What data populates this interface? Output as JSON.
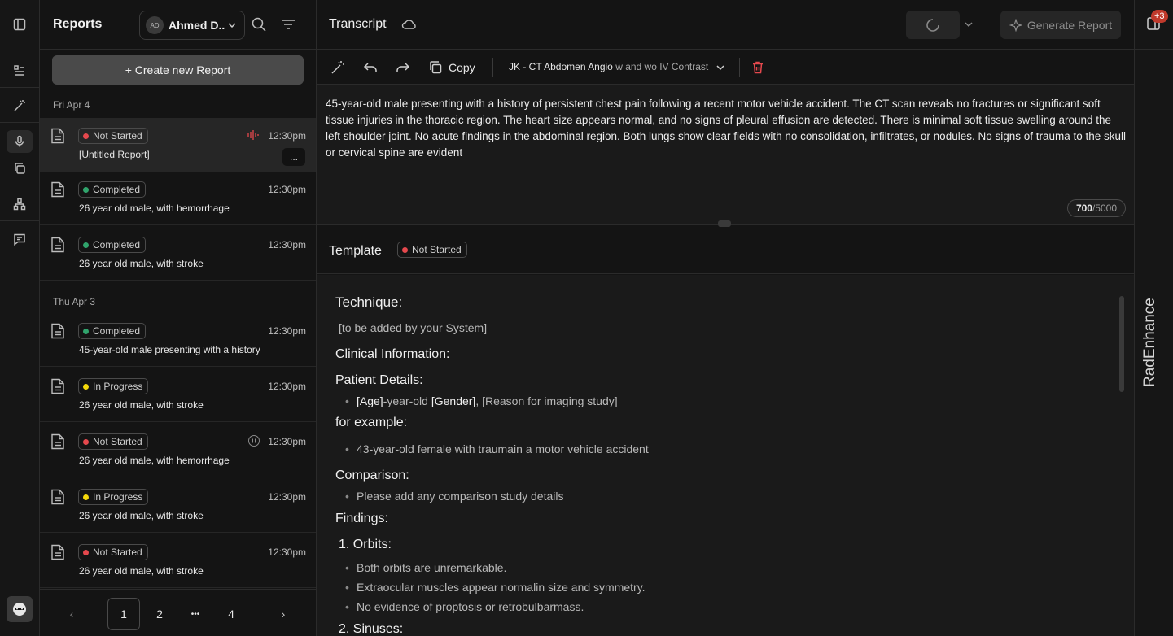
{
  "sidebar": {
    "avatar_label": "bot"
  },
  "reports_panel": {
    "title": "Reports",
    "user": {
      "initials": "AD",
      "name": "Ahmed D.."
    },
    "create_label": "+ Create new Report",
    "groups": [
      {
        "date": "Fri Apr 4"
      },
      {
        "date": "Thu Apr 3"
      }
    ],
    "items": [
      {
        "status": "Not Started",
        "status_color": "#e5484d",
        "time": "12:30pm",
        "title": "[Untitled Report]",
        "extra": "recording"
      },
      {
        "status": "Completed",
        "status_color": "#30a46c",
        "time": "12:30pm",
        "title": "26 year old male, with hemorrhage"
      },
      {
        "status": "Completed",
        "status_color": "#30a46c",
        "time": "12:30pm",
        "title": "26 year old male, with stroke"
      },
      {
        "status": "Completed",
        "status_color": "#30a46c",
        "time": "12:30pm",
        "title": "45-year-old male presenting with a history"
      },
      {
        "status": "In Progress",
        "status_color": "#f5d90a",
        "time": "12:30pm",
        "title": "26 year old male, with stroke"
      },
      {
        "status": "Not Started",
        "status_color": "#e5484d",
        "time": "12:30pm",
        "title": "26 year old male, with hemorrhage",
        "extra": "paused"
      },
      {
        "status": "In Progress",
        "status_color": "#f5d90a",
        "time": "12:30pm",
        "title": "26 year old male, with stroke"
      },
      {
        "status": "Not Started",
        "status_color": "#e5484d",
        "time": "12:30pm",
        "title": "26 year old male, with stroke"
      }
    ],
    "more_label": "...",
    "pagination": {
      "pages": [
        "1",
        "2",
        "•••",
        "4"
      ],
      "current": "1"
    }
  },
  "main": {
    "transcript_title": "Transcript",
    "generate_label": "Generate Report",
    "toolbar": {
      "copy_label": "Copy",
      "template_name": "JK - CT Abdomen Angio",
      "template_suffix": " w and wo IV Contrast"
    },
    "transcript_text": "45-year-old male presenting with a history of persistent chest pain following a recent motor vehicle accident. The CT scan reveals no fractures or significant soft tissue injuries in the thoracic region. The heart size appears normal, and no signs of pleural effusion are detected. There is minimal soft tissue swelling around the left shoulder joint. No acute findings in the abdominal region. Both lungs show clear fields with no consolidation, infiltrates, or nodules. No signs of trauma to the skull or cervical spine are evident",
    "counter": {
      "used": "700",
      "max": "/5000"
    },
    "template_title": "Template",
    "template_status": "Not Started",
    "template_status_color": "#e5484d",
    "template_content": {
      "technique_h": "Technique:",
      "technique_p": "[to be added by your System]",
      "clinical_h": "Clinical Information:",
      "patient_h": "Patient Details:",
      "patient_li": {
        "age": "[Age]",
        "mid": "-year-old ",
        "gender": "[Gender]",
        "rest": ", [Reason for imaging study]"
      },
      "example_h": "for example:",
      "example_li": "43-year-old female with traumain a motor vehicle accident",
      "comparison_h": "Comparison:",
      "comparison_li": "Please add any comparison study details",
      "findings_h": "Findings:",
      "orbits_h": "1. Orbits:",
      "orbits_li": [
        "Both orbits are unremarkable.",
        "Extraocular muscles appear normalin size and symmetry.",
        "No evidence of proptosis or retrobulbarmass."
      ],
      "sinuses_h": "2. Sinuses:"
    }
  },
  "right_strip": {
    "badge": "+3",
    "brand": "RadEnhance"
  }
}
